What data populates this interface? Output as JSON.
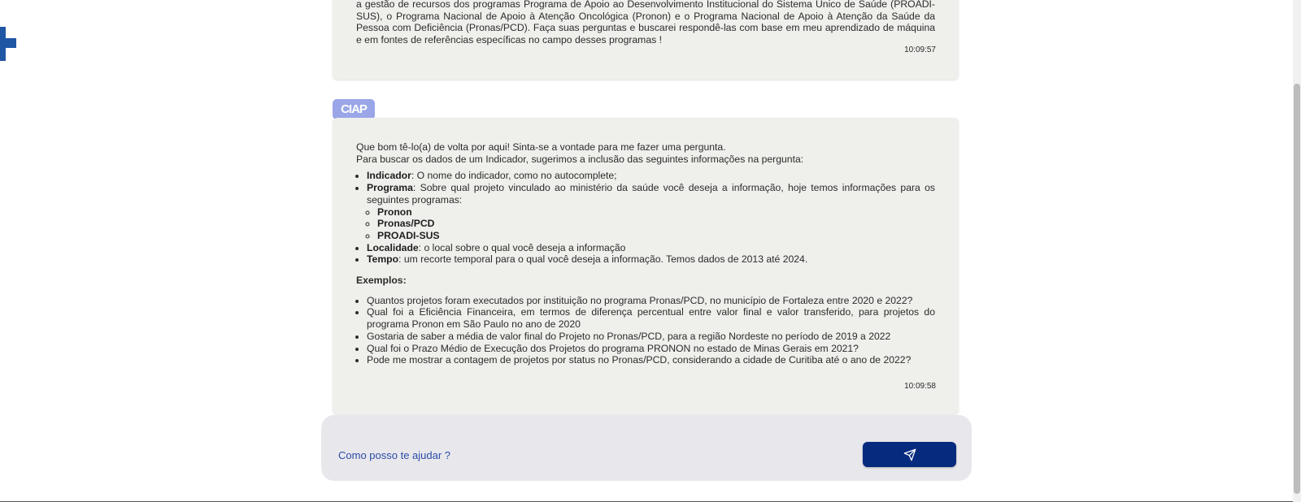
{
  "bubble1": {
    "text": "a gestão de recursos dos programas Programa de Apoio ao Desenvolvimento Institucional do Sistema Único de Saúde (PROADI-SUS), o Programa Nacional de Apoio à Atenção Oncológica (Pronon) e o Programa Nacional de Apoio à Atenção da Saúde da Pessoa com Deficiência (Pronas/PCD). Faça suas perguntas e buscarei respondê-las com base em meu aprendizado de máquina e em fontes de referências específicas no campo desses programas !",
    "time": "10:09:57"
  },
  "bot": {
    "badge": "CIAP"
  },
  "bubble2": {
    "intro1": "Que bom tê-lo(a) de volta por aqui! Sinta-se a vontade para me fazer uma pergunta.",
    "intro2": "Para buscar os dados de um Indicador, sugerimos a inclusão das seguintes informações na pergunta:",
    "items": [
      {
        "label": "Indicador",
        "text": ": O nome do indicador, como no autocomplete;"
      },
      {
        "label": "Programa",
        "text": ": Sobre qual projeto vinculado ao ministério da saúde você deseja a informação, hoje temos informações para os seguintes programas:"
      },
      {
        "label": "Localidade",
        "text": ": o local sobre o qual você deseja a informação"
      },
      {
        "label": "Tempo",
        "text": ": um recorte temporal para o qual você deseja a informação. Temos dados de 2013 até 2024."
      }
    ],
    "programs": [
      "Pronon",
      "Pronas/PCD",
      "PROADI-SUS"
    ],
    "examples_title": "Exemplos:",
    "examples": [
      "Quantos projetos foram executados por instituição no programa Pronas/PCD, no município de Fortaleza entre 2020 e 2022?",
      "Qual foi a Eficiência Financeira, em termos de diferença percentual entre valor final e valor transferido, para projetos do programa Pronon em São Paulo no ano de 2020",
      "Gostaria de saber a média de valor final do Projeto no Pronas/PCD, para a região Nordeste no período de 2019 a 2022",
      "Qual foi o Prazo Médio de Execução dos Projetos do programa PRONON no estado de Minas Gerais em 2021?",
      "Pode me mostrar a contagem de projetos por status no Pronas/PCD, considerando a cidade de Curitiba até o ano de 2022?"
    ],
    "time": "10:09:58"
  },
  "input": {
    "placeholder": "Como posso te ajudar ?"
  },
  "icons": {
    "send": "send-icon",
    "logo": "health-cross-logo"
  },
  "colors": {
    "accent": "#062a7e",
    "badge": "#9aa6e8",
    "logo": "#1f57a5",
    "bubble": "#efefec"
  }
}
